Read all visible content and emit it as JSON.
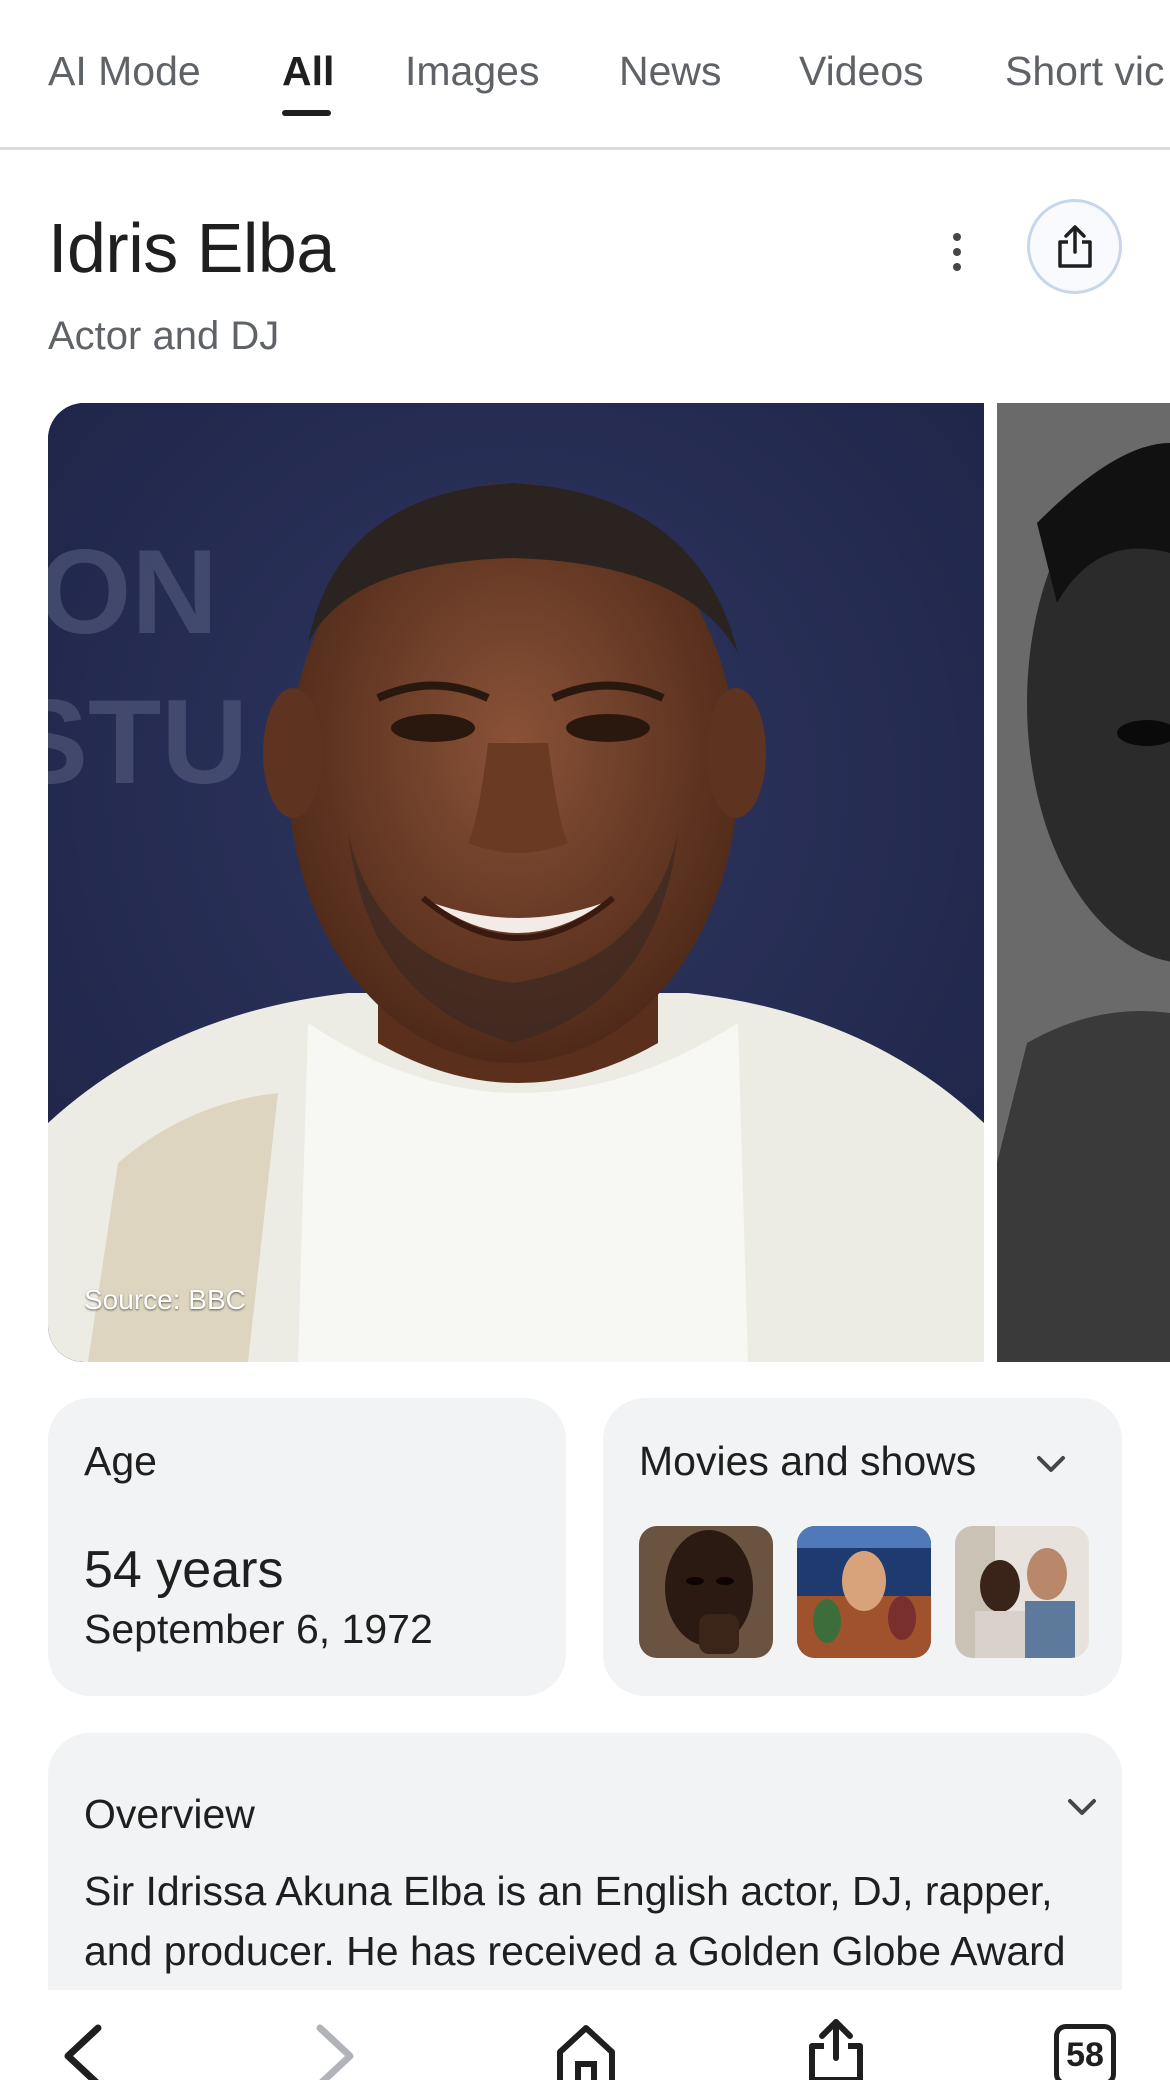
{
  "tabs": [
    {
      "label": "AI Mode"
    },
    {
      "label": "All"
    },
    {
      "label": "Images"
    },
    {
      "label": "News"
    },
    {
      "label": "Videos"
    },
    {
      "label": "Short vic"
    }
  ],
  "active_tab": "All",
  "entity": {
    "title": "Idris Elba",
    "subtitle": "Actor and DJ"
  },
  "image_caption": "Source: BBC",
  "age_card": {
    "label": "Age",
    "value": "54 years",
    "birth_date": "September 6, 1972"
  },
  "movies_card": {
    "label": "Movies and shows",
    "thumbnails": [
      "movie-thumb-1",
      "movie-thumb-2",
      "movie-thumb-3"
    ]
  },
  "overview": {
    "title": "Overview",
    "text": "Sir Idrissa Akuna Elba is an English actor, DJ, rapper, and producer. He has received a Golden Globe Award as well as nominations for three BAFTA"
  },
  "bottom_bar": {
    "tab_count": "58"
  },
  "icons": [
    "more-vert-icon",
    "share-icon",
    "chevron-down-icon",
    "back-icon",
    "forward-icon",
    "home-icon",
    "share-icon",
    "tabs-icon"
  ]
}
